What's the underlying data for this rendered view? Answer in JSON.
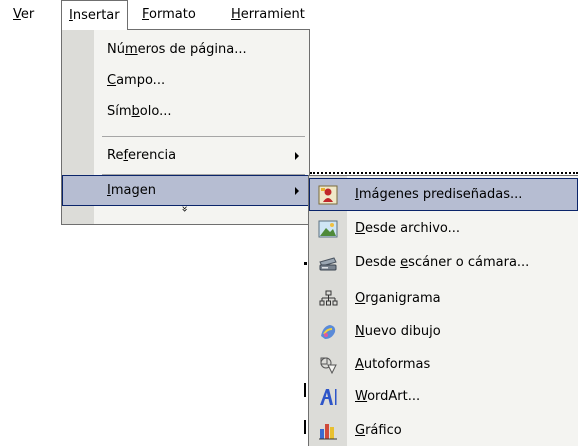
{
  "menubar": {
    "items": [
      {
        "label": "Ver",
        "mnemonic": "V",
        "rest": "er"
      },
      {
        "label": "Insertar",
        "mnemonic": "I",
        "rest": "nsertar"
      },
      {
        "label": "Formato",
        "mnemonic": "F",
        "rest": "ormato"
      },
      {
        "label": "Herramient",
        "mnemonic": "H",
        "rest": "erramient"
      }
    ]
  },
  "insert_menu": {
    "items": [
      {
        "pre": "Nú",
        "mn": "m",
        "post": "eros de página..."
      },
      {
        "pre": "",
        "mn": "C",
        "post": "ampo..."
      },
      {
        "pre": "Sím",
        "mn": "b",
        "post": "olo..."
      },
      {
        "pre": "Re",
        "mn": "f",
        "post": "erencia"
      },
      {
        "pre": "",
        "mn": "I",
        "post": "magen"
      }
    ],
    "more_glyph": "»"
  },
  "image_submenu": {
    "items": [
      {
        "pre": "",
        "mn": "I",
        "post": "mágenes prediseñadas...",
        "icon": "clipart-icon"
      },
      {
        "pre": "",
        "mn": "D",
        "post": "esde archivo...",
        "icon": "picture-file-icon"
      },
      {
        "pre": "Desde ",
        "mn": "e",
        "post": "scáner o cámara...",
        "icon": "scanner-icon"
      },
      {
        "pre": "",
        "mn": "O",
        "post": "rganigrama",
        "icon": "org-chart-icon"
      },
      {
        "pre": "",
        "mn": "N",
        "post": "uevo dibujo",
        "icon": "new-drawing-icon"
      },
      {
        "pre": "",
        "mn": "A",
        "post": "utoformas",
        "icon": "autoshapes-icon"
      },
      {
        "pre": "",
        "mn": "W",
        "post": "ordArt...",
        "icon": "wordart-icon"
      },
      {
        "pre": "",
        "mn": "G",
        "post": "ráfico",
        "icon": "chart-icon"
      }
    ]
  }
}
